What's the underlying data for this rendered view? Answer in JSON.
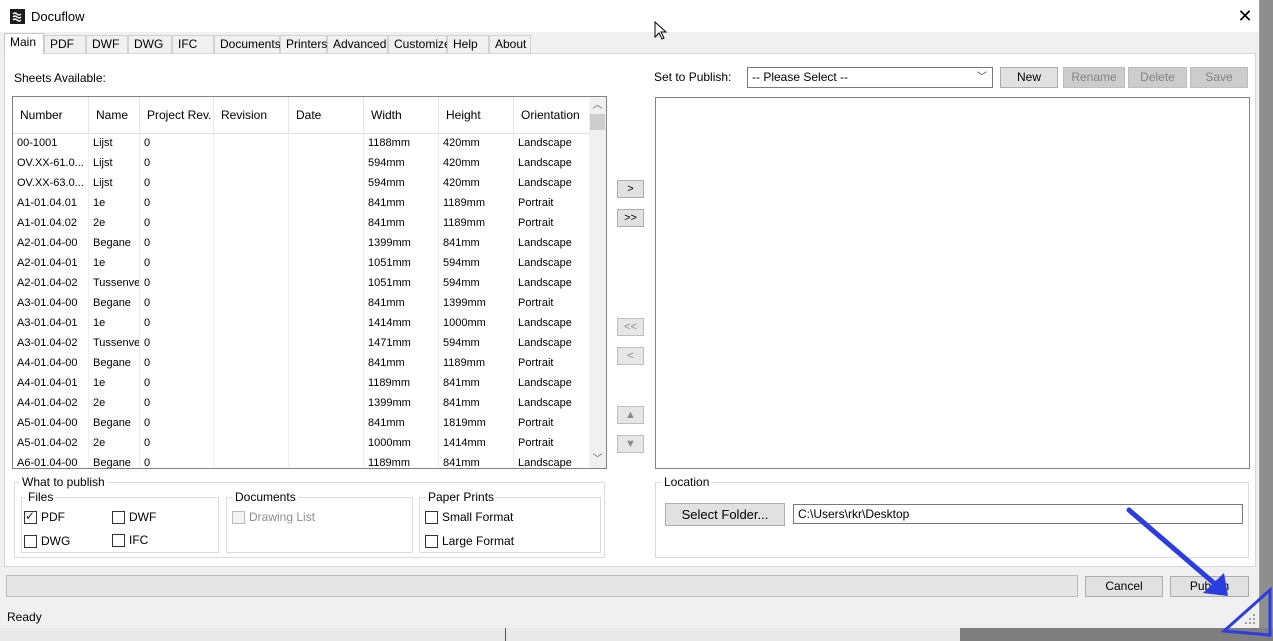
{
  "window": {
    "title": "Docuflow"
  },
  "tabs": [
    "Main",
    "PDF",
    "DWF",
    "DWG",
    "IFC",
    "Documents",
    "Printers",
    "Advanced",
    "Customize",
    "Help",
    "About"
  ],
  "sheets": {
    "label": "Sheets Available:",
    "columns": [
      "Number",
      "Name",
      "Project Rev.",
      "Revision",
      "Date",
      "Width",
      "Height",
      "Orientation"
    ],
    "rows": [
      [
        "00-1001",
        "Lijst",
        "0",
        "",
        "",
        "1188mm",
        "420mm",
        "Landscape"
      ],
      [
        "OV.XX-61.0...",
        "Lijst",
        "0",
        "",
        "",
        "594mm",
        "420mm",
        "Landscape"
      ],
      [
        "OV.XX-63.0...",
        "Lijst",
        "0",
        "",
        "",
        "594mm",
        "420mm",
        "Landscape"
      ],
      [
        "A1-01.04.01",
        "1e",
        "0",
        "",
        "",
        "841mm",
        "1189mm",
        "Portrait"
      ],
      [
        "A1-01.04.02",
        "2e",
        "0",
        "",
        "",
        "841mm",
        "1189mm",
        "Portrait"
      ],
      [
        "A2-01.04-00",
        "Begane",
        "0",
        "",
        "",
        "1399mm",
        "841mm",
        "Landscape"
      ],
      [
        "A2-01.04-01",
        "1e",
        "0",
        "",
        "",
        "1051mm",
        "594mm",
        "Landscape"
      ],
      [
        "A2-01.04-02",
        "Tussenve",
        "0",
        "",
        "",
        "1051mm",
        "594mm",
        "Landscape"
      ],
      [
        "A3-01.04-00",
        "Begane",
        "0",
        "",
        "",
        "841mm",
        "1399mm",
        "Portrait"
      ],
      [
        "A3-01.04-01",
        "1e",
        "0",
        "",
        "",
        "1414mm",
        "1000mm",
        "Landscape"
      ],
      [
        "A3-01.04-02",
        "Tussenve",
        "0",
        "",
        "",
        "1471mm",
        "594mm",
        "Landscape"
      ],
      [
        "A4-01.04-00",
        "Begane",
        "0",
        "",
        "",
        "841mm",
        "1189mm",
        "Portrait"
      ],
      [
        "A4-01.04-01",
        "1e",
        "0",
        "",
        "",
        "1189mm",
        "841mm",
        "Landscape"
      ],
      [
        "A4-01.04-02",
        "2e",
        "0",
        "",
        "",
        "1399mm",
        "841mm",
        "Landscape"
      ],
      [
        "A5-01.04-00",
        "Begane",
        "0",
        "",
        "",
        "841mm",
        "1819mm",
        "Portrait"
      ],
      [
        "A5-01.04-02",
        "2e",
        "0",
        "",
        "",
        "1000mm",
        "1414mm",
        "Portrait"
      ],
      [
        "A6-01.04-00",
        "Begane",
        "0",
        "",
        "",
        "1189mm",
        "841mm",
        "Landscape"
      ]
    ]
  },
  "move_buttons": {
    "add": ">",
    "add_all": ">>",
    "remove_all": "<<",
    "remove": "<",
    "up": "▲",
    "down": "▼"
  },
  "set_to_publish": {
    "label": "Set to Publish:",
    "selected": "-- Please Select --",
    "new": "New",
    "rename": "Rename",
    "delete": "Delete",
    "save": "Save"
  },
  "what_to_publish": {
    "title": "What to publish",
    "files": {
      "title": "Files",
      "pdf": "PDF",
      "dwf": "DWF",
      "dwg": "DWG",
      "ifc": "IFC",
      "pdf_checked": true
    },
    "documents": {
      "title": "Documents",
      "drawing_list": "Drawing List"
    },
    "paper_prints": {
      "title": "Paper Prints",
      "small": "Small Format",
      "large": "Large Format"
    }
  },
  "location": {
    "title": "Location",
    "select_folder": "Select Folder...",
    "path": "C:\\Users\\rkr\\Desktop"
  },
  "footer": {
    "cancel": "Cancel",
    "publish": "Publish",
    "progress": 0,
    "status": "Ready"
  },
  "colors": {
    "annotation_arrow": "#2b3de0",
    "button_face": "#e1e1e1",
    "disabled_button": "#cccccc"
  }
}
